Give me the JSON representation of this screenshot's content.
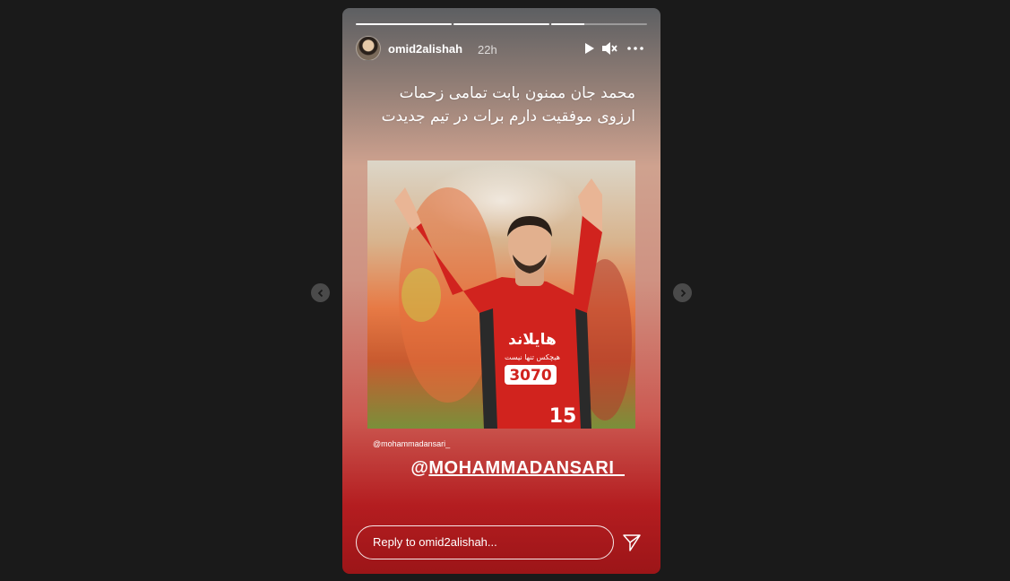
{
  "story": {
    "username": "omid2alishah",
    "time_ago": "22h",
    "caption_line1": "محمد جان ممنون بابت تمامی زحمات",
    "caption_line2": "ارزوی موفقیت دارم برات در تیم جدیدت",
    "photo_credit": "@mohammadansari_",
    "mention_at": "@",
    "mention_name": "MOHAMMADANSARI_",
    "jersey_sponsor": "هایلاند",
    "jersey_tagline": "هیچکس تنها نیست",
    "jersey_code": "3070",
    "jersey_number": "15",
    "progress": [
      1,
      1,
      0.35,
      0,
      0
    ]
  },
  "reply": {
    "placeholder": "Reply to omid2alishah..."
  },
  "icons": {
    "play": "play-icon",
    "mute": "mute-icon",
    "more": "more-icon",
    "send": "send-icon",
    "prev": "chevron-left-icon",
    "next": "chevron-right-icon"
  }
}
